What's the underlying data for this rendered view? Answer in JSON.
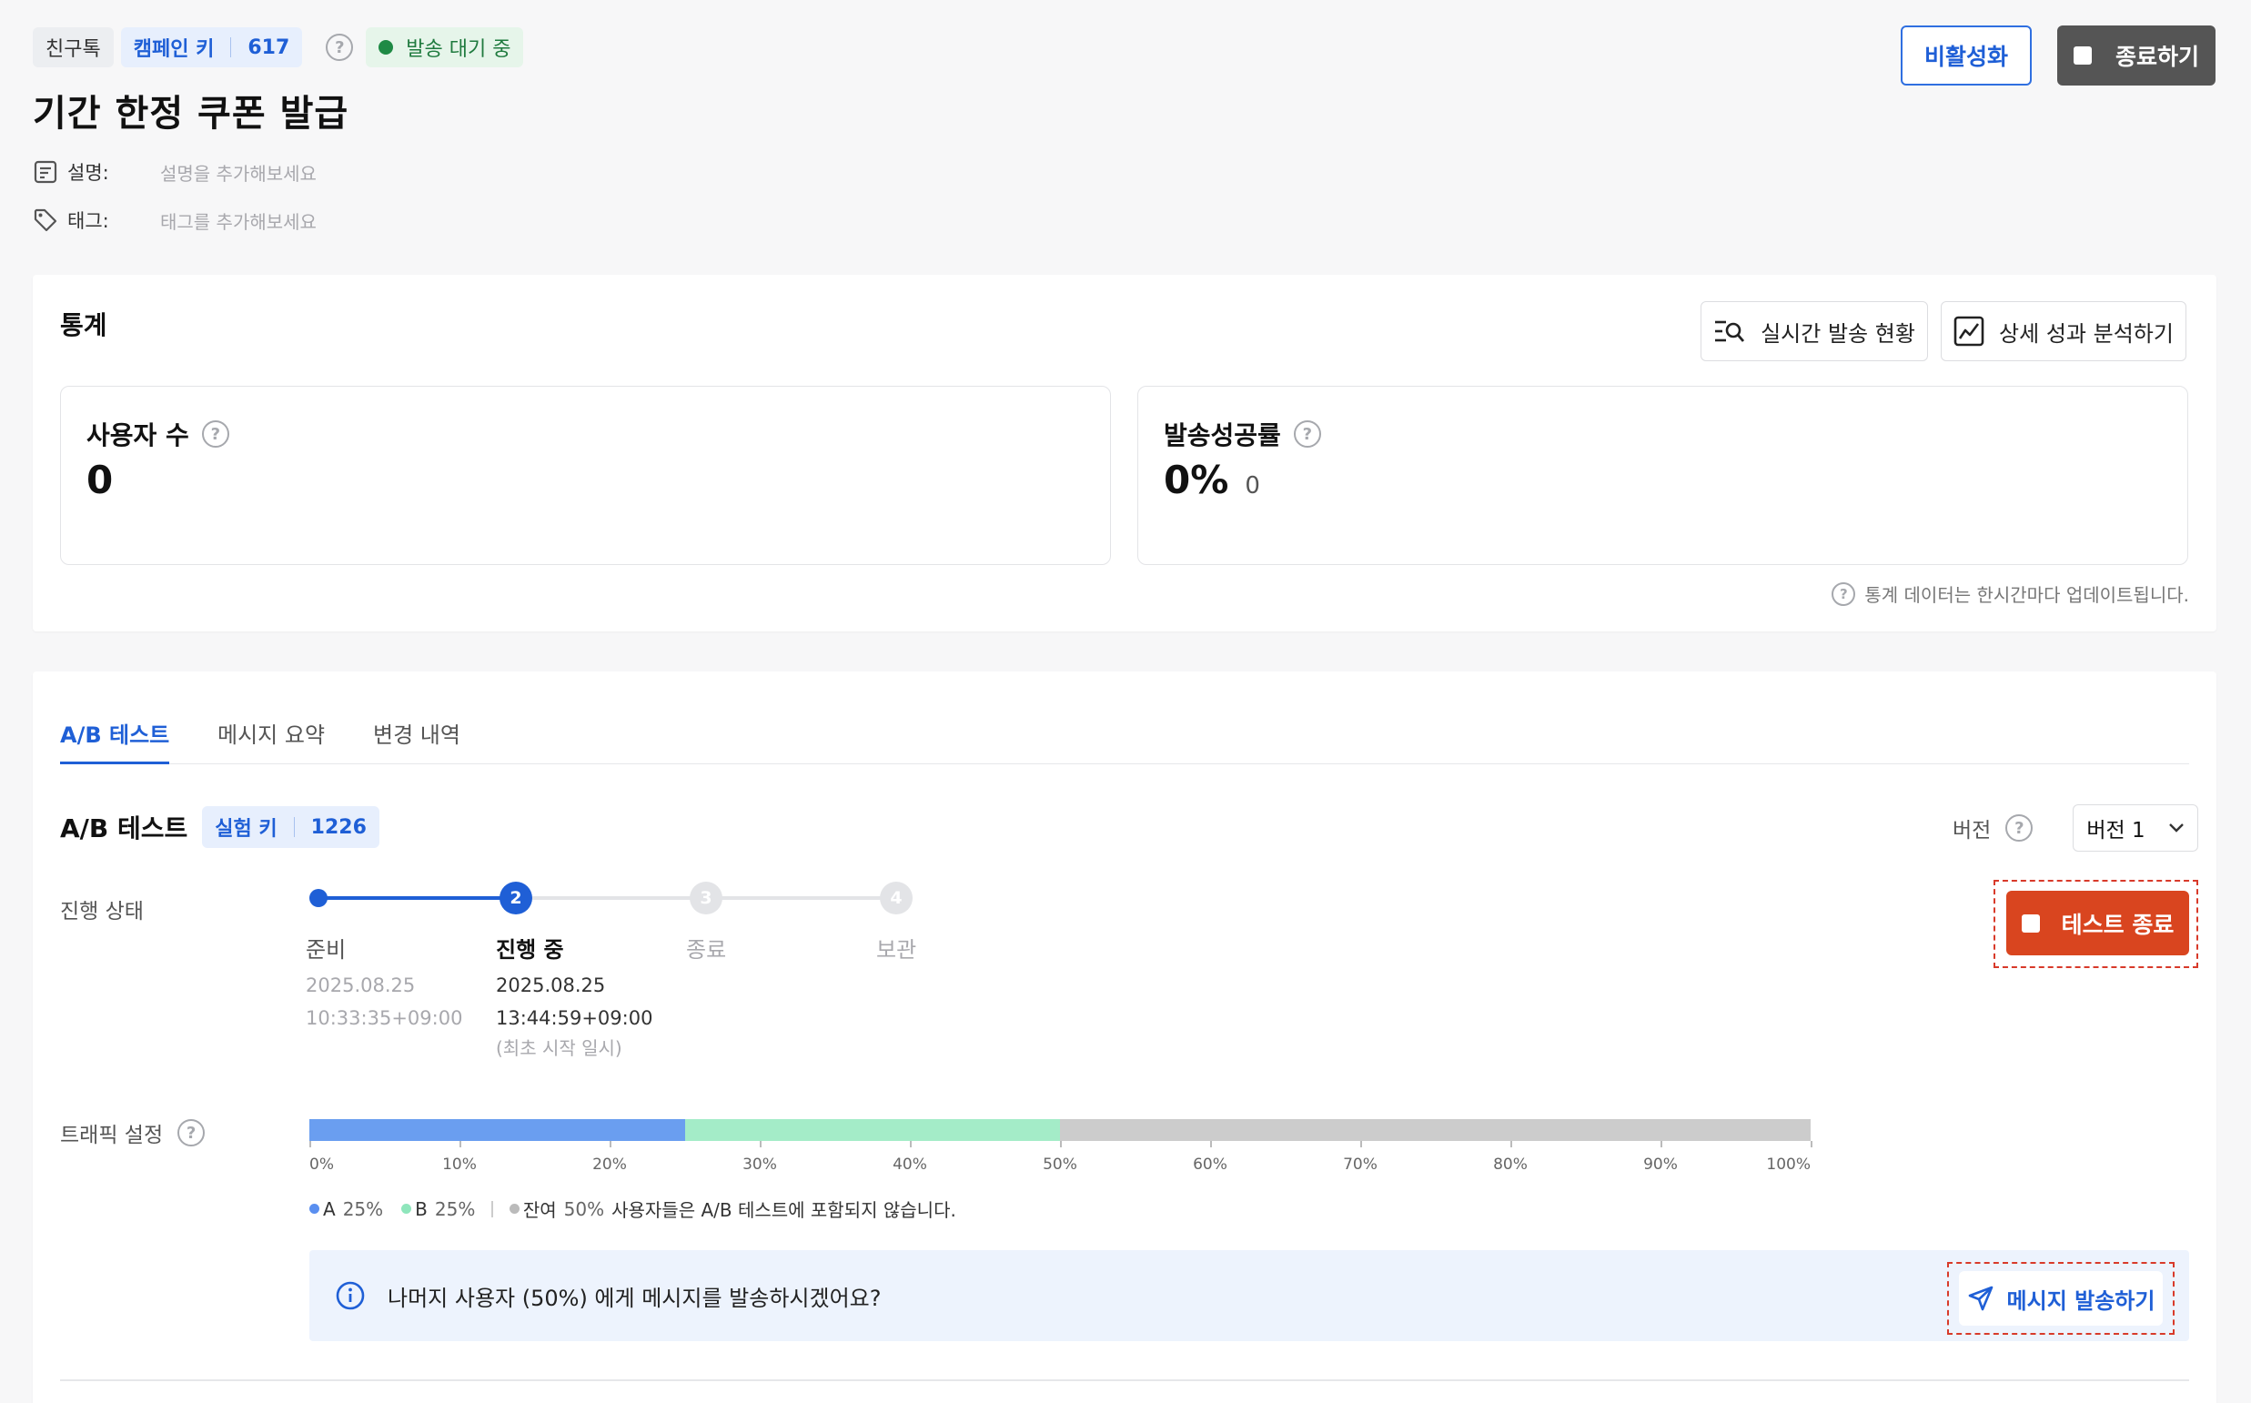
{
  "header": {
    "channel": "친구톡",
    "campaign_key_label": "캠페인 키",
    "campaign_key_value": "617",
    "help_icon": "question-icon",
    "status": "발송 대기 중",
    "status_color": "#1f8a45",
    "title": "기간 한정 쿠폰 발급",
    "deactivate_label": "비활성화",
    "end_label": "종료하기",
    "desc_label": "설명:",
    "desc_placeholder": "설명을 추가해보세요",
    "tag_label": "태그:",
    "tag_placeholder": "태그를 추가해보세요"
  },
  "stats": {
    "title": "통계",
    "realtime_button": "실시간 발송 현황",
    "analysis_button": "상세 성과 분석하기",
    "users_label": "사용자 수",
    "users_value": "0",
    "success_label": "발송성공률",
    "success_value": "0%",
    "success_count": "0",
    "footnote": "통계 데이터는 한시간마다 업데이트됩니다."
  },
  "tabs": [
    {
      "label": "A/B 테스트",
      "active": true
    },
    {
      "label": "메시지 요약",
      "active": false
    },
    {
      "label": "변경 내역",
      "active": false
    }
  ],
  "ab": {
    "title": "A/B 테스트",
    "exp_key_label": "실험 키",
    "exp_key_value": "1226",
    "version_label": "버전",
    "version_value": "버전 1",
    "progress_label": "진행 상태",
    "end_test_button": "테스트 종료",
    "steps": [
      {
        "num": "1",
        "label": "준비",
        "date": "2025.08.25",
        "time": "10:33:35+09:00",
        "note": "",
        "state": "done"
      },
      {
        "num": "2",
        "label": "진행 중",
        "date": "2025.08.25",
        "time": "13:44:59+09:00",
        "note": "(최초 시작 일시)",
        "state": "current"
      },
      {
        "num": "3",
        "label": "종료",
        "date": "",
        "time": "",
        "note": "",
        "state": "pending"
      },
      {
        "num": "4",
        "label": "보관",
        "date": "",
        "time": "",
        "note": "",
        "state": "pending"
      }
    ],
    "traffic_label": "트래픽 설정",
    "traffic": {
      "a_percent": 25,
      "b_percent": 25,
      "rest_percent": 50,
      "a_color": "#6a9ef0",
      "b_color": "#a4ecc8",
      "rest_color": "#cccccc",
      "ticks": [
        "0%",
        "10%",
        "20%",
        "30%",
        "40%",
        "50%",
        "60%",
        "70%",
        "80%",
        "90%",
        "100%"
      ]
    },
    "legend": {
      "a_name": "A",
      "a_value": "25%",
      "b_name": "B",
      "b_value": "25%",
      "rest_name": "잔여",
      "rest_value": "50%",
      "rest_text": "사용자들은 A/B 테스트에 포함되지 않습니다."
    },
    "notice_text": "나머지 사용자 (50%) 에게 메시지를 발송하시겠어요?",
    "send_button": "메시지 발송하기"
  }
}
